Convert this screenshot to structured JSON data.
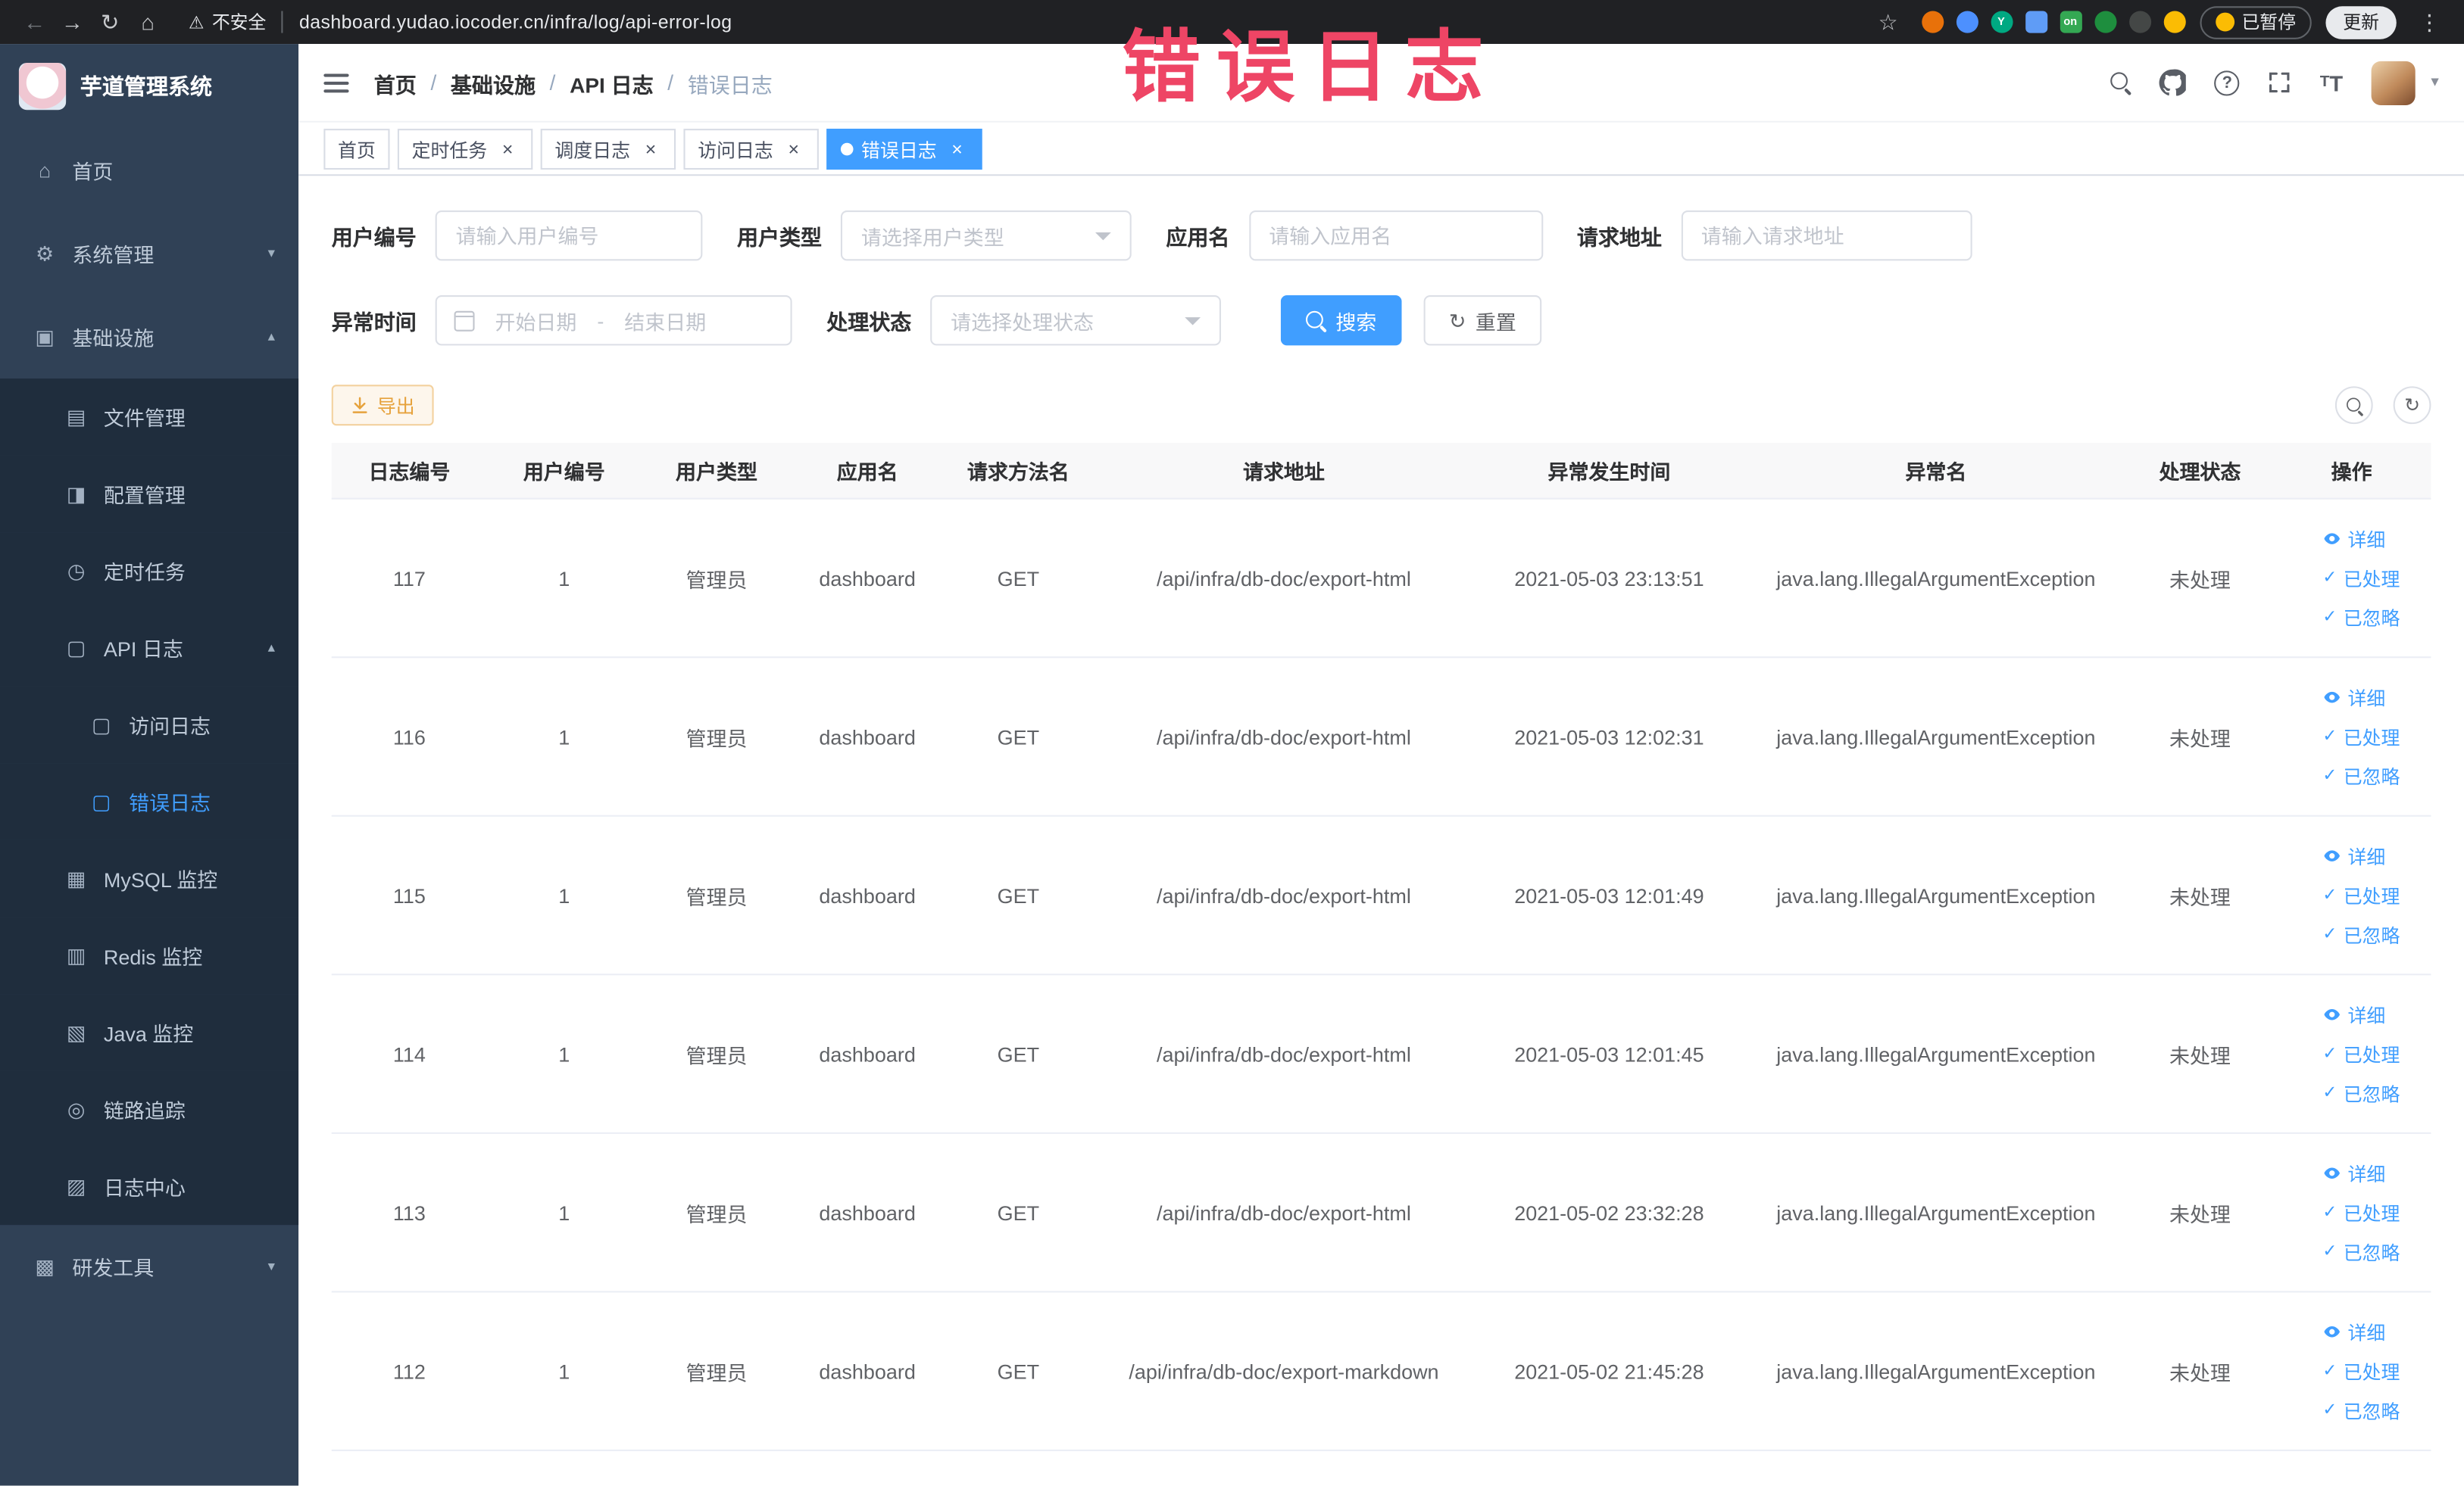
{
  "annotation": {
    "text": "错误日志"
  },
  "browser": {
    "security_label": "不安全",
    "url": "dashboard.yudao.iocoder.cn/infra/log/api-error-log",
    "paused_badge": "已暂停",
    "update_button": "更新",
    "extensions": [
      {
        "color": "#e8710a"
      },
      {
        "color": "#4d90fe"
      },
      {
        "color": "#00a982",
        "letter": "Y"
      },
      {
        "color": "#5f9cf6",
        "shape": "square"
      },
      {
        "color": "#34a853",
        "letter": "on",
        "shape": "square"
      },
      {
        "color": "#1e8e3e"
      },
      {
        "color": "#444746"
      },
      {
        "color": "#fbbc04"
      }
    ]
  },
  "sidebar": {
    "title": "芋道管理系统",
    "menu": [
      {
        "key": "home",
        "label": "首页",
        "level": 0,
        "icon": "home"
      },
      {
        "key": "system",
        "label": "系统管理",
        "level": 0,
        "icon": "system",
        "arrow": "down"
      },
      {
        "key": "infra",
        "label": "基础设施",
        "level": 0,
        "icon": "infra",
        "arrow": "up"
      },
      {
        "key": "file",
        "label": "文件管理",
        "level": 1,
        "icon": "file"
      },
      {
        "key": "config",
        "label": "配置管理",
        "level": 1,
        "icon": "config"
      },
      {
        "key": "job",
        "label": "定时任务",
        "level": 1,
        "icon": "job"
      },
      {
        "key": "api-log",
        "label": "API 日志",
        "level": 1,
        "icon": "api-log",
        "arrow": "up"
      },
      {
        "key": "access-log",
        "label": "访问日志",
        "level": 2,
        "icon": "doc"
      },
      {
        "key": "error-log",
        "label": "错误日志",
        "level": 2,
        "icon": "doc",
        "active": true
      },
      {
        "key": "mysql",
        "label": "MySQL 监控",
        "level": 1,
        "icon": "mysql"
      },
      {
        "key": "redis",
        "label": "Redis 监控",
        "level": 1,
        "icon": "redis"
      },
      {
        "key": "java",
        "label": "Java 监控",
        "level": 1,
        "icon": "java"
      },
      {
        "key": "trace",
        "label": "链路追踪",
        "level": 1,
        "icon": "trace"
      },
      {
        "key": "log-center",
        "label": "日志中心",
        "level": 1,
        "icon": "log-center"
      },
      {
        "key": "dev-tools",
        "label": "研发工具",
        "level": 0,
        "icon": "dev-tools",
        "arrow": "down"
      }
    ]
  },
  "icon_glyphs": {
    "home": "⌂",
    "system": "⚙",
    "infra": "▣",
    "file": "▤",
    "config": "◨",
    "job": "◷",
    "api-log": "▢",
    "doc": "▢",
    "mysql": "▦",
    "redis": "▥",
    "java": "▧",
    "trace": "◎",
    "log-center": "▨",
    "dev-tools": "▩"
  },
  "navbar": {
    "breadcrumb": [
      "首页",
      "基础设施",
      "API 日志",
      "错误日志"
    ]
  },
  "tabs": [
    {
      "key": "home",
      "label": "首页",
      "closable": false,
      "active": false
    },
    {
      "key": "job",
      "label": "定时任务",
      "closable": true,
      "active": false
    },
    {
      "key": "job-log",
      "label": "调度日志",
      "closable": true,
      "active": false
    },
    {
      "key": "access-log",
      "label": "访问日志",
      "closable": true,
      "active": false
    },
    {
      "key": "error-log",
      "label": "错误日志",
      "closable": true,
      "active": true
    }
  ],
  "filters": {
    "user_id_label": "用户编号",
    "user_id_placeholder": "请输入用户编号",
    "user_type_label": "用户类型",
    "user_type_placeholder": "请选择用户类型",
    "app_name_label": "应用名",
    "app_name_placeholder": "请输入应用名",
    "request_url_label": "请求地址",
    "request_url_placeholder": "请输入请求地址",
    "time_label": "异常时间",
    "time_start_placeholder": "开始日期",
    "time_separator": "-",
    "time_end_placeholder": "结束日期",
    "status_label": "处理状态",
    "status_placeholder": "请选择处理状态",
    "search_button": "搜索",
    "reset_button": "重置"
  },
  "toolbar": {
    "export_button": "导出"
  },
  "table": {
    "columns": [
      "日志编号",
      "用户编号",
      "用户类型",
      "应用名",
      "请求方法名",
      "请求地址",
      "异常发生时间",
      "异常名",
      "处理状态",
      "操作"
    ],
    "action_labels": {
      "detail": "详细",
      "processed": "已处理",
      "ignored": "已忽略"
    },
    "rows": [
      {
        "id": "117",
        "user_id": "1",
        "user_type": "管理员",
        "app_name": "dashboard",
        "method": "GET",
        "url": "/api/infra/db-doc/export-html",
        "time": "2021-05-03 23:13:51",
        "exception": "java.lang.IllegalArgumentException",
        "status": "未处理"
      },
      {
        "id": "116",
        "user_id": "1",
        "user_type": "管理员",
        "app_name": "dashboard",
        "method": "GET",
        "url": "/api/infra/db-doc/export-html",
        "time": "2021-05-03 12:02:31",
        "exception": "java.lang.IllegalArgumentException",
        "status": "未处理"
      },
      {
        "id": "115",
        "user_id": "1",
        "user_type": "管理员",
        "app_name": "dashboard",
        "method": "GET",
        "url": "/api/infra/db-doc/export-html",
        "time": "2021-05-03 12:01:49",
        "exception": "java.lang.IllegalArgumentException",
        "status": "未处理"
      },
      {
        "id": "114",
        "user_id": "1",
        "user_type": "管理员",
        "app_name": "dashboard",
        "method": "GET",
        "url": "/api/infra/db-doc/export-html",
        "time": "2021-05-03 12:01:45",
        "exception": "java.lang.IllegalArgumentException",
        "status": "未处理"
      },
      {
        "id": "113",
        "user_id": "1",
        "user_type": "管理员",
        "app_name": "dashboard",
        "method": "GET",
        "url": "/api/infra/db-doc/export-html",
        "time": "2021-05-02 23:32:28",
        "exception": "java.lang.IllegalArgumentException",
        "status": "未处理"
      },
      {
        "id": "112",
        "user_id": "1",
        "user_type": "管理员",
        "app_name": "dashboard",
        "method": "GET",
        "url": "/api/infra/db-doc/export-markdown",
        "time": "2021-05-02 21:45:28",
        "exception": "java.lang.IllegalArgumentException",
        "status": "未处理"
      }
    ]
  },
  "colors": {
    "accent": "#409EFF",
    "sidebar_bg": "#304156",
    "submenu_bg": "#1f2d3d",
    "warning": "#E6A23C",
    "annotation": "#ee4565"
  }
}
